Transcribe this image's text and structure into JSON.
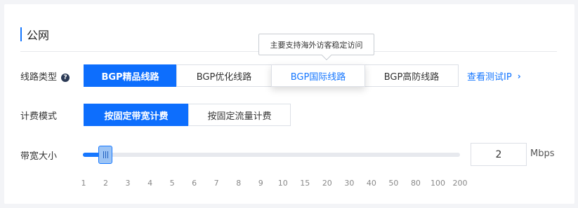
{
  "section": {
    "title": "公网"
  },
  "line_type": {
    "label": "线路类型",
    "help_icon": "?",
    "options": [
      "BGP精品线路",
      "BGP优化线路",
      "BGP国际线路",
      "BGP高防线路"
    ],
    "selected": "BGP精品线路",
    "hovered": "BGP国际线路",
    "tooltip": "主要支持海外访客稳定访问",
    "test_link": "查看测试IP",
    "link_chevron": "›"
  },
  "billing": {
    "label": "计费模式",
    "options": [
      "按固定带宽计费",
      "按固定流量计费"
    ],
    "selected": "按固定带宽计费"
  },
  "bandwidth": {
    "label": "带宽大小",
    "value": "2",
    "unit": "Mbps",
    "ticks": [
      "1",
      "2",
      "3",
      "4",
      "5",
      "6",
      "7",
      "8",
      "9",
      "10",
      "15",
      "20",
      "30",
      "40",
      "50",
      "80",
      "100",
      "200"
    ],
    "slider_level_fraction": 0.0588
  },
  "colors": {
    "accent": "#1677ff",
    "active_bg": "#0d6efd"
  },
  "icons": {
    "help": "question-circle-icon",
    "link": "chevron-right-icon",
    "handle": "grip-icon"
  }
}
